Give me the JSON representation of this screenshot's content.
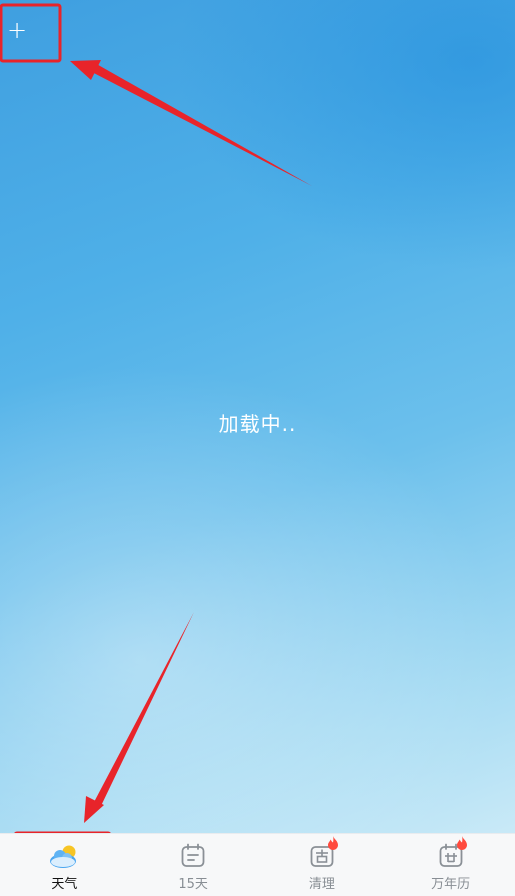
{
  "header": {
    "add_label": "+"
  },
  "main": {
    "loading_text": "加载中.."
  },
  "tabbar": {
    "tabs": [
      {
        "label": "天气",
        "icon": "weather-icon",
        "active": true
      },
      {
        "label": "15天",
        "icon": "calendar-icon",
        "active": false
      },
      {
        "label": "清理",
        "icon": "clean-icon",
        "active": false
      },
      {
        "label": "万年历",
        "icon": "almanac-icon",
        "active": false
      }
    ]
  },
  "colors": {
    "annotation": "#e8242a",
    "fire": "#ff4a3d",
    "sun": "#f7c525",
    "cloud": "#4aa6f0"
  }
}
